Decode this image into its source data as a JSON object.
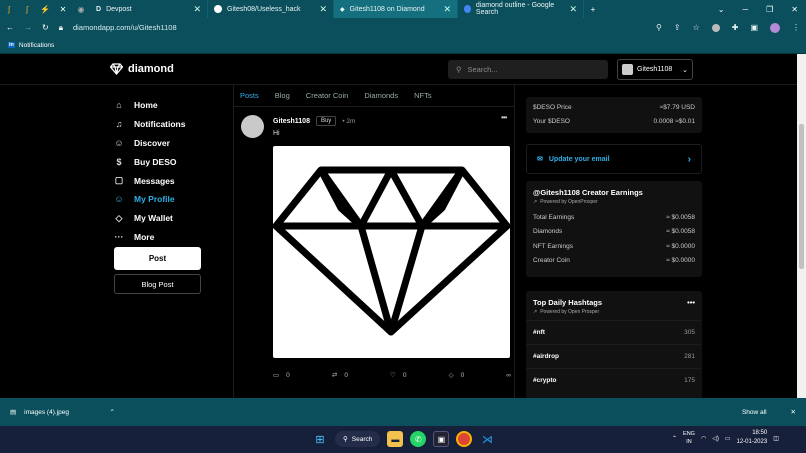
{
  "browser": {
    "pinned_tabs": [
      "pin-app-1",
      "pin-app-2",
      "pin-app-3",
      "pin-app-x",
      "pin-app-5"
    ],
    "tabs": [
      {
        "label": "Devpost",
        "icon": "D"
      },
      {
        "label": "Gitesh08/Useless_hack",
        "icon": "github-icon"
      },
      {
        "label": "Gitesh1108 on Diamond",
        "icon": "diamond-icon"
      },
      {
        "label": "diamond outline - Google Search",
        "icon": "google-icon"
      }
    ],
    "new_tab": "+",
    "url": "diamondapp.com/u/Gitesh1108",
    "bookmark": "Notifications",
    "bookmark_badge": "in"
  },
  "app": {
    "logo_text": "diamond",
    "search_placeholder": "Search...",
    "user_button": "Gitesh1108",
    "nav": [
      {
        "label": "Home",
        "icon": "⌂",
        "name": "home-icon"
      },
      {
        "label": "Notifications",
        "icon": "♫",
        "name": "bell-icon"
      },
      {
        "label": "Discover",
        "icon": "☺",
        "name": "people-icon"
      },
      {
        "label": "Buy DESO",
        "icon": "$",
        "name": "dollar-icon"
      },
      {
        "label": "Messages",
        "icon": "▢",
        "name": "message-icon"
      },
      {
        "label": "My Profile",
        "icon": "☺",
        "name": "profile-icon"
      },
      {
        "label": "My Wallet",
        "icon": "◇",
        "name": "wallet-icon"
      },
      {
        "label": "More",
        "icon": "···",
        "name": "more-icon"
      }
    ],
    "post_button": "Post",
    "blog_post_button": "Blog Post"
  },
  "feed": {
    "tabs": [
      "Posts",
      "Blog",
      "Creator Coin",
      "Diamonds",
      "NFTs"
    ],
    "post": {
      "username": "Gitesh1108",
      "buy_label": "Buy",
      "time": "• 2m",
      "text": "Hi",
      "comments": "0",
      "reposts": "0",
      "likes": "0",
      "diamonds": "0"
    }
  },
  "sidebar": {
    "price_rows": [
      {
        "label": "$DESO Price",
        "value": "≈$7.79 USD"
      },
      {
        "label": "Your $DESO",
        "value": "0.0008 ≈$0.01"
      }
    ],
    "email_cta": "Update your email",
    "earnings_title": "@Gitesh1108 Creator Earnings",
    "earnings_powered": "Powered by OpenProsper",
    "earnings_rows": [
      {
        "label": "Total Earnings",
        "value": "≈ $0.0058"
      },
      {
        "label": "Diamonds",
        "value": "≈ $0.0058"
      },
      {
        "label": "NFT Earnings",
        "value": "≈ $0.0000"
      },
      {
        "label": "Creator Coin",
        "value": "≈ $0.0000"
      }
    ],
    "hashtags_title": "Top Daily Hashtags",
    "hashtags_powered": "Powered by Open Prosper",
    "hashtags": [
      {
        "tag": "#nft",
        "count": "305"
      },
      {
        "tag": "#airdrop",
        "count": "281"
      },
      {
        "tag": "#crypto",
        "count": "175"
      }
    ]
  },
  "downloads": {
    "file": "images (4).jpeg",
    "show_all": "Show all"
  },
  "taskbar": {
    "search": "Search",
    "lang_top": "ENG",
    "lang_bottom": "IN",
    "time": "18:50",
    "date": "12-01-2023"
  },
  "colors": {
    "accent": "#30b0e6",
    "chrome": "#0b4f5c",
    "taskbar": "#17203a"
  }
}
